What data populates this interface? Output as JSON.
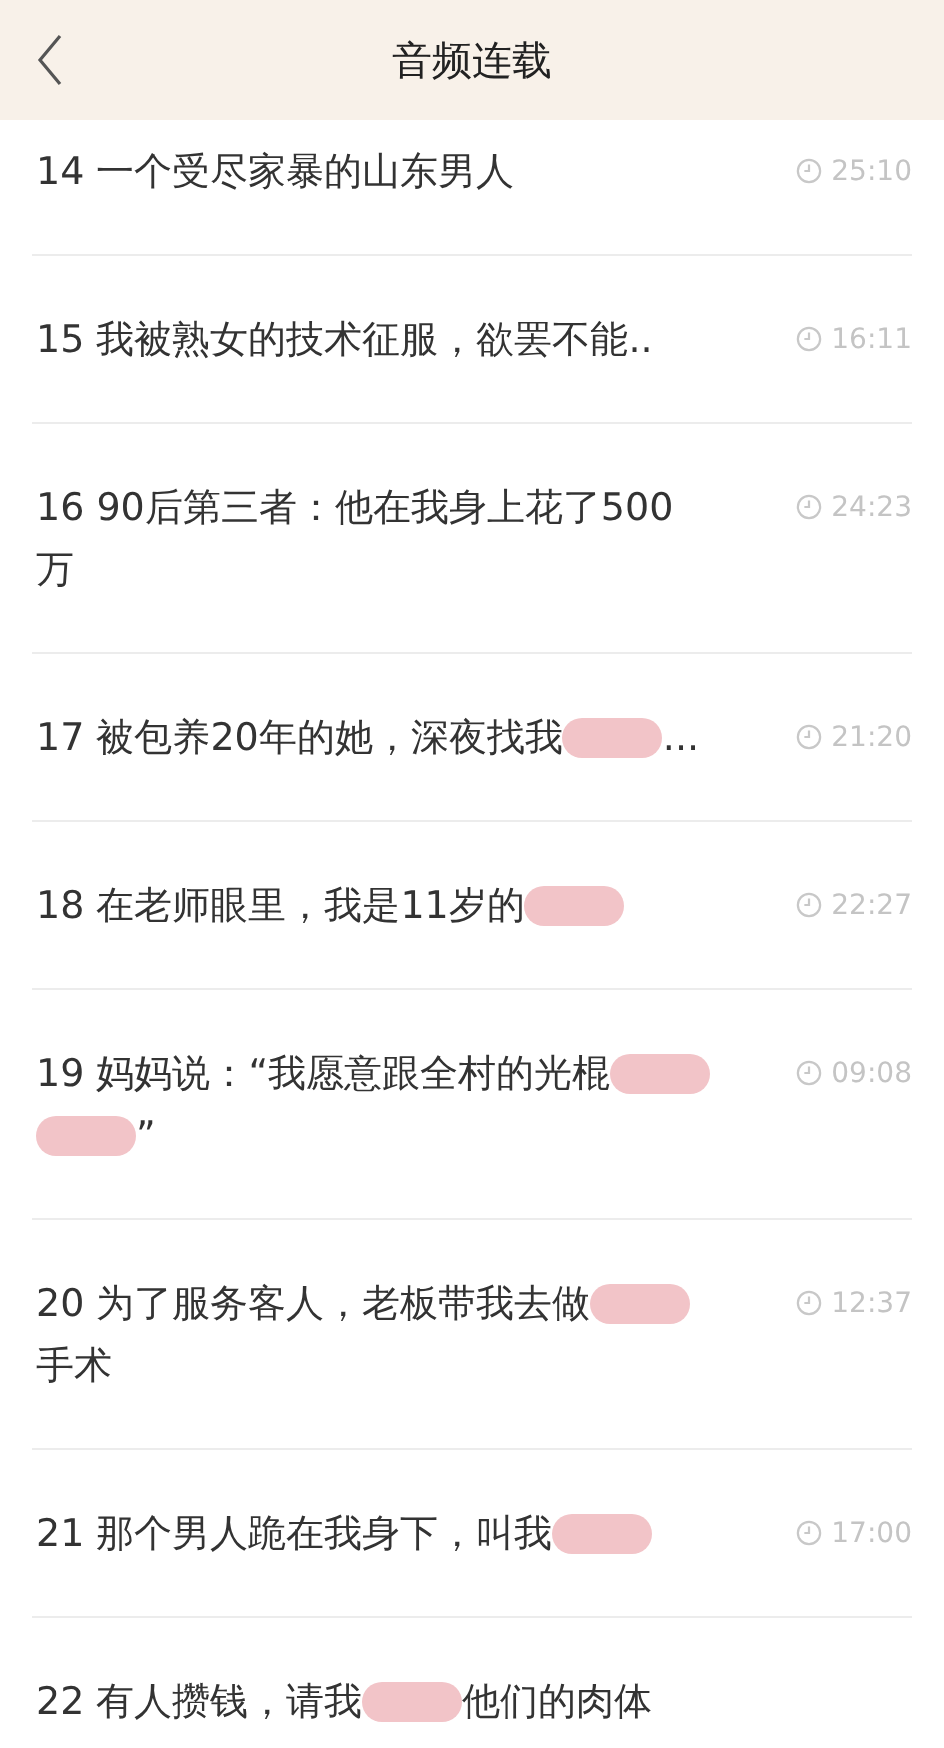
{
  "header": {
    "title": "音频连载"
  },
  "episodes": [
    {
      "lines": [
        [
          {
            "kind": "text",
            "text": "14 一个受尽家暴的山东男人"
          }
        ]
      ],
      "duration": "25:10"
    },
    {
      "lines": [
        [
          {
            "kind": "text",
            "text": "15 我被熟女的技术征服，欲罢不能.."
          }
        ]
      ],
      "duration": "16:11"
    },
    {
      "lines": [
        [
          {
            "kind": "text",
            "text": "16 90后第三者：他在我身上花了500"
          }
        ],
        [
          {
            "kind": "text",
            "text": "万"
          }
        ]
      ],
      "duration": "24:23"
    },
    {
      "lines": [
        [
          {
            "kind": "text",
            "text": "17 被包养20年的她，深夜找我"
          },
          {
            "kind": "redaction"
          },
          {
            "kind": "text",
            "text": "..."
          }
        ]
      ],
      "duration": "21:20"
    },
    {
      "lines": [
        [
          {
            "kind": "text",
            "text": "18 在老师眼里，我是11岁的"
          },
          {
            "kind": "redaction"
          }
        ]
      ],
      "duration": "22:27"
    },
    {
      "lines": [
        [
          {
            "kind": "text",
            "text": "19 妈妈说：“我愿意跟全村的光棍"
          },
          {
            "kind": "redaction"
          }
        ],
        [
          {
            "kind": "redaction"
          },
          {
            "kind": "text",
            "text": "”"
          }
        ]
      ],
      "duration": "09:08"
    },
    {
      "lines": [
        [
          {
            "kind": "text",
            "text": "20 为了服务客人，老板带我去做"
          },
          {
            "kind": "redaction"
          }
        ],
        [
          {
            "kind": "text",
            "text": "手术"
          }
        ]
      ],
      "duration": "12:37"
    },
    {
      "lines": [
        [
          {
            "kind": "text",
            "text": "21 那个男人跪在我身下，叫我"
          },
          {
            "kind": "redaction"
          }
        ]
      ],
      "duration": "17:00"
    },
    {
      "lines": [
        [
          {
            "kind": "text",
            "text": "22 有人攒钱，请我"
          },
          {
            "kind": "redaction"
          },
          {
            "kind": "text",
            "text": "他们的肉体"
          }
        ]
      ]
    }
  ]
}
